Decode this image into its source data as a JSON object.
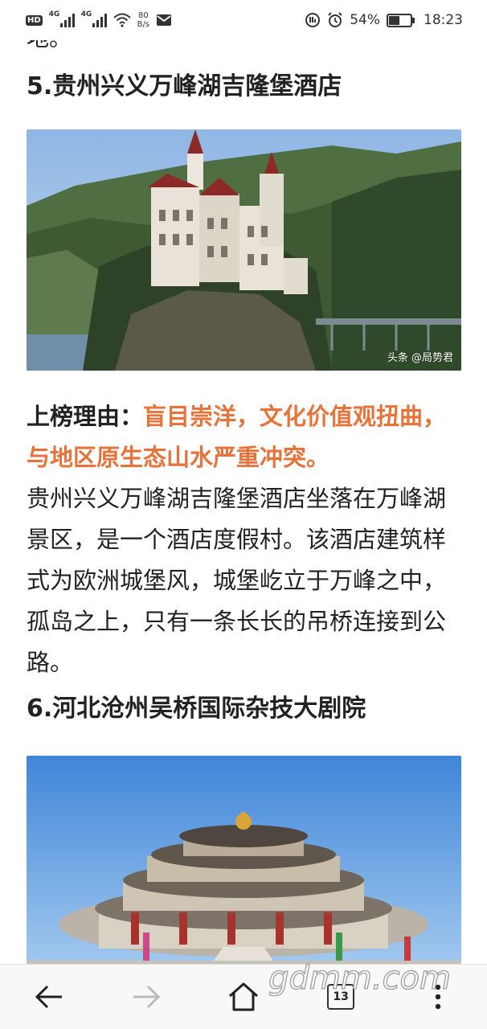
{
  "status_bar": {
    "hd": "HD",
    "sim1_net": "4G",
    "sim2_net": "4G",
    "speed_value": "80",
    "speed_unit": "B/s",
    "battery_percent": "54%",
    "battery_level": 0.54,
    "time": "18:23"
  },
  "article": {
    "prev_fragment": "地。",
    "heading_5": "5.贵州兴义万峰湖吉隆堡酒店",
    "image1_watermark": "头条 @局势君",
    "reason_label": "上榜理由：",
    "reason_text": "盲目崇洋，文化价值观扭曲，与地区原生态山水严重冲突。",
    "paragraph": "贵州兴义万峰湖吉隆堡酒店坐落在万峰湖景区，是一个酒店度假村。该酒店建筑样式为欧洲城堡风，城堡屹立于万峰之中，孤岛之上，只有一条长长的吊桥连接到公路。",
    "heading_6": "6.河北沧州吴桥国际杂技大剧院"
  },
  "nav": {
    "tab_count": "13"
  },
  "site_watermark": "gdmm.com",
  "colors": {
    "highlight": "#e8733a"
  }
}
